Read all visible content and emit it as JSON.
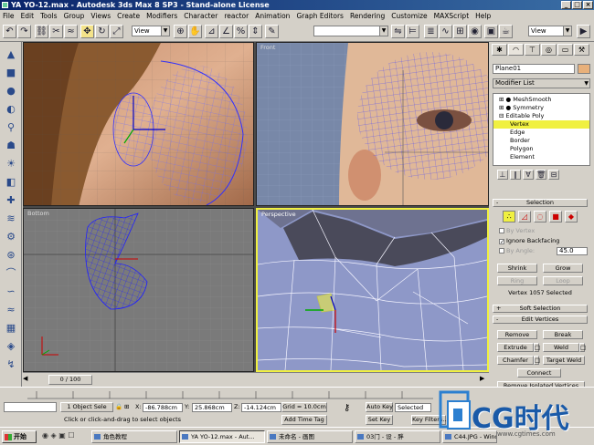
{
  "window": {
    "title": "YA YO-12.max - Autodesk 3ds Max 8 SP3 - Stand-alone License"
  },
  "menu": [
    "File",
    "Edit",
    "Tools",
    "Group",
    "Views",
    "Create",
    "Modifiers",
    "Character",
    "reactor",
    "Animation",
    "Graph Editors",
    "Rendering",
    "Customize",
    "MAXScript",
    "Help"
  ],
  "toolbar": {
    "refcoord": "View",
    "view2": "View",
    "selset": ""
  },
  "viewports": {
    "top_left": "",
    "top_right": "Front",
    "bottom_left": "Bottom",
    "bottom_right": "Perspective"
  },
  "cmd": {
    "object_name": "Plane01",
    "object_color": "#e8b07a",
    "modifier_list": "Modifier List",
    "stack": [
      "MeshSmooth",
      "Symmetry",
      "Editable Poly",
      "Vertex",
      "Edge",
      "Border",
      "Polygon",
      "Element"
    ],
    "selection": {
      "title": "Selection",
      "by_vertex": "By Vertex",
      "ignore_backfacing": "Ignore Backfacing",
      "by_angle": "By Angle:",
      "angle_value": "45.0",
      "shrink": "Shrink",
      "grow": "Grow",
      "ring": "Ring",
      "loop": "Loop",
      "status": "Vertex 1057 Selected"
    },
    "soft_selection": "Soft Selection",
    "edit_vertices": {
      "title": "Edit Vertices",
      "remove": "Remove",
      "break": "Break",
      "extrude": "Extrude",
      "weld": "Weld",
      "chamfer": "Chamfer",
      "target_weld": "Target Weld",
      "connect": "Connect",
      "remove_isolated": "Remove Isolated Vertices"
    }
  },
  "timeline": {
    "frame": "0 / 100"
  },
  "status": {
    "objects": "1 Object Sele",
    "x_label": "X:",
    "x": "-86.788cm",
    "y_label": "Y:",
    "y": "25.868cm",
    "z_label": "Z:",
    "z": "-14.124cm",
    "grid": "Grid = 10.0cm",
    "auto_key": "Auto Key",
    "selected": "Selected",
    "set_key": "Set Key",
    "key_filters": "Key Filters...",
    "prompt": "Click or click-and-drag to select objects",
    "add_time_tag": "Add Time Tag"
  },
  "taskbar": {
    "start": "开始",
    "items": [
      "角色教程",
      "YA YO-12.max - Aut...",
      "未命名 - 画图",
      "03门 - 设 - 胖",
      "C44.JPG - Windows ..."
    ],
    "clock": "12:00"
  },
  "watermark": {
    "text": "CG时代",
    "url": "www.cgtimes.com"
  },
  "colors": {
    "accent": "#f4e38a",
    "selection_yellow": "#f0f040",
    "wire_blue": "#3030ff",
    "vp_active": "#f0f040"
  }
}
